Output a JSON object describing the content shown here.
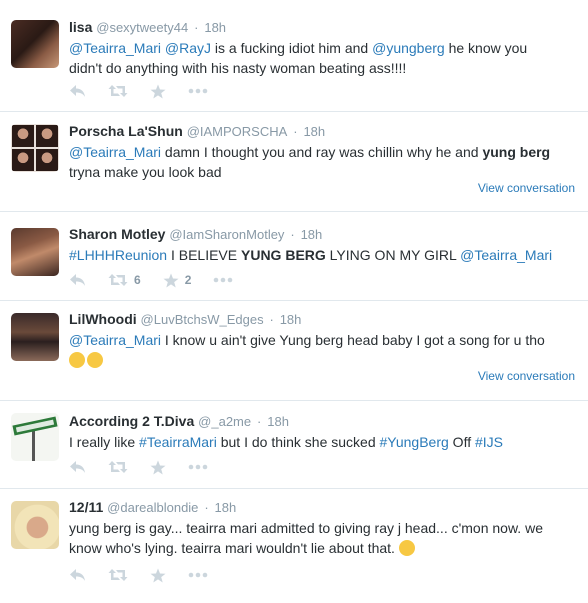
{
  "tweets": [
    {
      "fullname": "lisa",
      "handle": "@sexytweety44",
      "time": "18h",
      "line1": [
        {
          "t": "@Teairra_Mari",
          "c": "link"
        },
        {
          "t": " ",
          "c": ""
        },
        {
          "t": "@RayJ",
          "c": "link"
        },
        {
          "t": " is a fucking idiot him and ",
          "c": ""
        },
        {
          "t": "@yungberg",
          "c": "link"
        },
        {
          "t": " he know you",
          "c": ""
        }
      ],
      "line2": [
        {
          "t": "didn't do anything with his nasty woman beating ass!!!!",
          "c": ""
        }
      ]
    },
    {
      "fullname": "Porscha La'Shun",
      "handle": "@IAMPORSCHA",
      "time": "18h",
      "line1": [
        {
          "t": "@Teairra_Mari",
          "c": "link"
        },
        {
          "t": " damn I thought you and ray was chillin why he and ",
          "c": ""
        },
        {
          "t": "yung berg",
          "c": "bold"
        }
      ],
      "line2": [
        {
          "t": "tryna make you look bad",
          "c": ""
        }
      ],
      "view_conversation": "View conversation"
    },
    {
      "fullname": "Sharon Motley",
      "handle": "@IamSharonMotley",
      "time": "18h",
      "line1": [
        {
          "t": "#LHHHReunion",
          "c": "link"
        },
        {
          "t": " I BELIEVE ",
          "c": ""
        },
        {
          "t": "YUNG BERG",
          "c": "bold"
        },
        {
          "t": " LYING ON MY GIRL ",
          "c": ""
        },
        {
          "t": "@Teairra_Mari",
          "c": "link"
        }
      ],
      "retweets": "6",
      "favorites": "2"
    },
    {
      "fullname": "LilWhoodi",
      "handle": "@LuvBtchsW_Edges",
      "time": "18h",
      "line1": [
        {
          "t": "@Teairra_Mari",
          "c": "link"
        },
        {
          "t": " I know u ain't give Yung berg head baby I got a song for u tho",
          "c": ""
        }
      ],
      "emoji": [
        "kissing-face-emoji",
        "kissing-face-emoji"
      ],
      "view_conversation": "View conversation"
    },
    {
      "fullname": "According 2 T.Diva",
      "handle": "@_a2me",
      "time": "18h",
      "line1": [
        {
          "t": "I really like ",
          "c": ""
        },
        {
          "t": "#TeairraMari",
          "c": "link"
        },
        {
          "t": " but I do think she sucked ",
          "c": ""
        },
        {
          "t": "#YungBerg",
          "c": "link"
        },
        {
          "t": " Off ",
          "c": ""
        },
        {
          "t": "#IJS",
          "c": "link"
        }
      ]
    },
    {
      "fullname": "12/11",
      "handle": "@darealblondie",
      "time": "18h",
      "line1": [
        {
          "t": "yung berg is gay... teairra mari admitted to giving ray j head... c'mon now. we",
          "c": ""
        }
      ],
      "line2": [
        {
          "t": "know who's lying. teairra mari wouldn't lie about that.",
          "c": ""
        }
      ],
      "emoji": [
        "crying-face-emoji"
      ]
    }
  ],
  "dot": "·",
  "colors": {
    "link": "#2b7bb9",
    "icon": "#ccd6dd",
    "meta": "#8899a6"
  }
}
